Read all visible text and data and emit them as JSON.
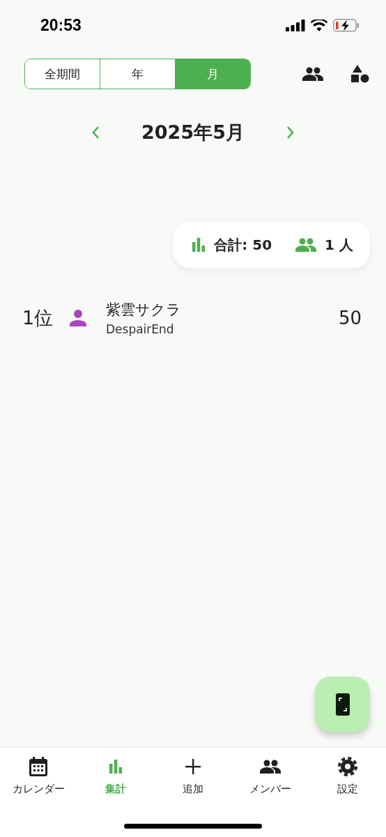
{
  "status_bar": {
    "time": "20:53"
  },
  "period_tabs": [
    {
      "label": "全期間",
      "selected": false
    },
    {
      "label": "年",
      "selected": false
    },
    {
      "label": "月",
      "selected": true
    }
  ],
  "month_nav": {
    "title": "2025年5月"
  },
  "summary": {
    "total": "合計: 50",
    "members": "1 人"
  },
  "ranking": [
    {
      "rank": "1位",
      "name": "紫雲サクラ",
      "subtitle": "DespairEnd",
      "score": "50",
      "color": "#ab47bc"
    }
  ],
  "nav": [
    {
      "kind": "calendar",
      "label": "カレンダー",
      "selected": false
    },
    {
      "kind": "stats",
      "label": "集計",
      "selected": true
    },
    {
      "kind": "add",
      "label": "追加",
      "selected": false
    },
    {
      "kind": "members",
      "label": "メンバー",
      "selected": false
    },
    {
      "kind": "settings",
      "label": "設定",
      "selected": false
    }
  ]
}
